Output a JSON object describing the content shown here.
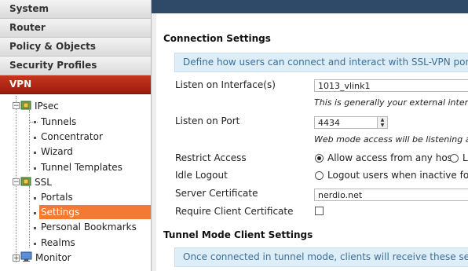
{
  "nav": {
    "sections": [
      {
        "label": "System",
        "active": false
      },
      {
        "label": "Router",
        "active": false
      },
      {
        "label": "Policy & Objects",
        "active": false
      },
      {
        "label": "Security Profiles",
        "active": false
      },
      {
        "label": "VPN",
        "active": true
      }
    ],
    "tree": {
      "ipsec": "IPsec",
      "tunnels": "Tunnels",
      "concentrator": "Concentrator",
      "wizard": "Wizard",
      "tunnel_templates": "Tunnel Templates",
      "ssl": "SSL",
      "portals": "Portals",
      "settings": "Settings",
      "personal_bookmarks": "Personal Bookmarks",
      "realms": "Realms",
      "monitor": "Monitor"
    },
    "selected": "Settings"
  },
  "connection": {
    "header": "Connection Settings",
    "info": "Define how users can connect and interact with SSL-VPN portals or",
    "listen_interface_label": "Listen on Interface(s)",
    "listen_interface_value": "1013_vlink1",
    "listen_interface_hint": "This is generally your external interfa",
    "listen_port_label": "Listen on Port",
    "listen_port_value": "4434",
    "listen_port_hint": "Web mode access will be listening at",
    "restrict_access_label": "Restrict Access",
    "restrict_option_any": "Allow access from any host",
    "restrict_option_other": "L",
    "idle_logout_label": "Idle Logout",
    "idle_logout_option": "Logout users when inactive for s",
    "server_cert_label": "Server Certificate",
    "server_cert_value": "nerdio.net",
    "require_client_cert_label": "Require Client Certificate",
    "require_client_cert_checked": false
  },
  "tunnel": {
    "header": "Tunnel Mode Client Settings",
    "info": "Once connected in tunnel mode, clients will receive these settings"
  },
  "colors": {
    "vpn_active": "#b02a14",
    "selected_item": "#f47a33",
    "top_band": "#2e4a68",
    "info_bg": "#ddeef9",
    "info_text": "#3d6e95"
  }
}
